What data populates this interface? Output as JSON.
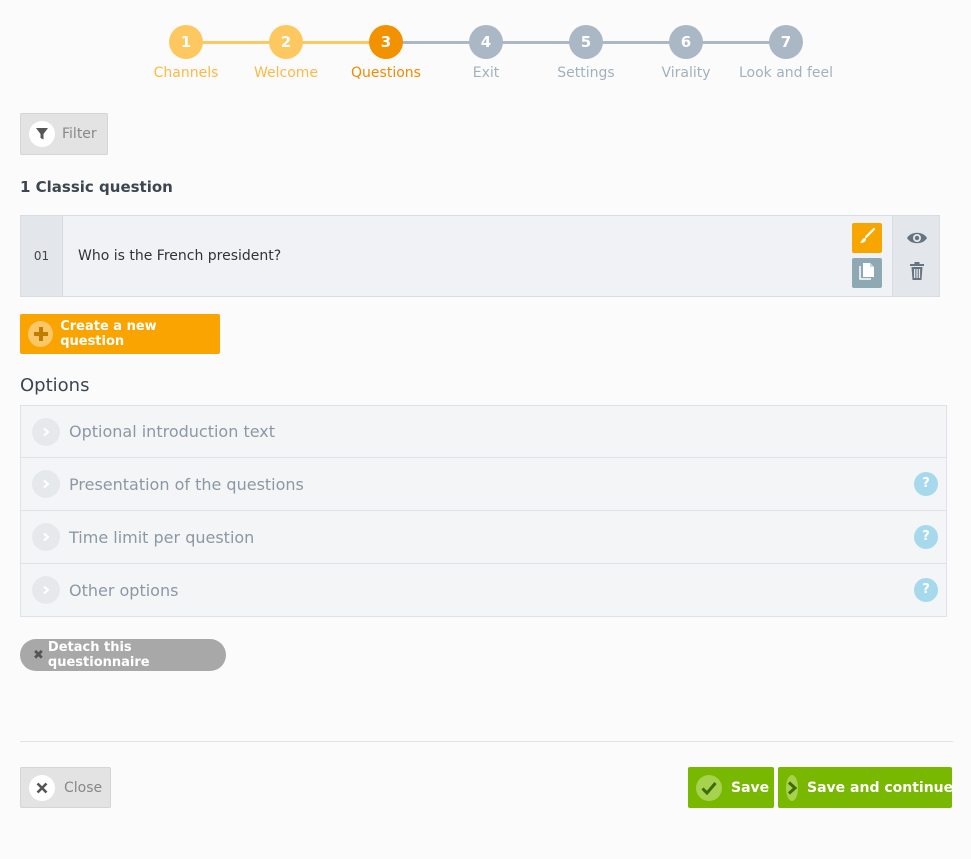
{
  "stepper": {
    "steps": [
      {
        "num": "1",
        "label": "Channels",
        "state": "done"
      },
      {
        "num": "2",
        "label": "Welcome",
        "state": "done"
      },
      {
        "num": "3",
        "label": "Questions",
        "state": "active"
      },
      {
        "num": "4",
        "label": "Exit",
        "state": "todo"
      },
      {
        "num": "5",
        "label": "Settings",
        "state": "todo"
      },
      {
        "num": "6",
        "label": "Virality",
        "state": "todo"
      },
      {
        "num": "7",
        "label": "Look and feel",
        "state": "todo"
      }
    ],
    "colors": {
      "done": "#fec860",
      "active": "#f39200",
      "todo": "#a9b8c4",
      "done_label": "#fcb944",
      "active_label": "#f28a00",
      "todo_label": "#a3b1bd"
    }
  },
  "filter": {
    "label": "Filter",
    "icon": "filter-icon"
  },
  "questions_heading": "1 Classic question",
  "questions": [
    {
      "number": "01",
      "text": "Who is the French president?"
    }
  ],
  "create_button": {
    "label": "Create a new question",
    "icon": "plus-icon"
  },
  "options": {
    "title": "Options",
    "items": [
      {
        "label": "Optional introduction text",
        "help": false
      },
      {
        "label": "Presentation of the questions",
        "help": true
      },
      {
        "label": "Time limit per question",
        "help": true
      },
      {
        "label": "Other options",
        "help": true
      }
    ],
    "help_glyph": "?"
  },
  "detach_button": {
    "label": "Detach this questionnaire",
    "glyph": "✖"
  },
  "footer": {
    "close_label": "Close",
    "save_label": "Save",
    "save_continue_label": "Save and continue"
  }
}
